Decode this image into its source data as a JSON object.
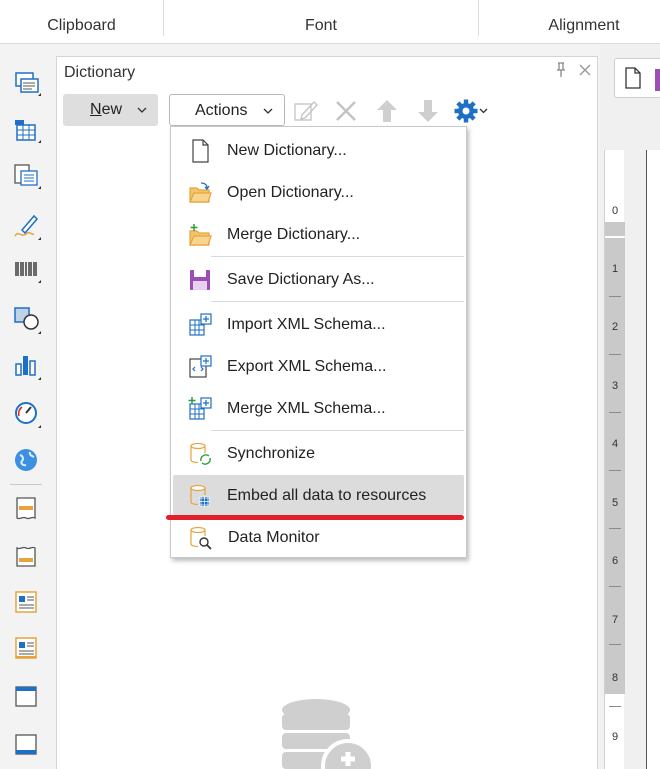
{
  "ribbon": {
    "groups": [
      "Clipboard",
      "Font",
      "Alignment"
    ]
  },
  "toolbox": {
    "items": [
      "text-icon",
      "table-icon",
      "cross-tab-icon",
      "shape-pen-icon",
      "barcode-icon",
      "shapes-icon",
      "chart-icon",
      "gauge-icon",
      "map-icon",
      "header-band-icon",
      "footer-band-icon",
      "data-band-icon",
      "databand-text-icon",
      "page-header-icon",
      "page-footer-icon"
    ]
  },
  "panel": {
    "title": "Dictionary",
    "new_button_prefix": "",
    "new_button_accel": "N",
    "new_button_rest": "ew",
    "actions_button": "Actions"
  },
  "menu": {
    "items": [
      {
        "label": "New Dictionary...",
        "icon": "new-document-icon"
      },
      {
        "label": "Open Dictionary...",
        "icon": "open-folder-icon"
      },
      {
        "label": "Merge Dictionary...",
        "icon": "merge-folder-icon"
      },
      {
        "label": "Save Dictionary As...",
        "icon": "save-icon"
      },
      {
        "label": "Import XML Schema...",
        "icon": "import-xml-icon"
      },
      {
        "label": "Export XML Schema...",
        "icon": "export-xml-icon"
      },
      {
        "label": "Merge XML Schema...",
        "icon": "merge-xml-icon"
      },
      {
        "label": "Synchronize",
        "icon": "synchronize-icon"
      },
      {
        "label": "Embed all data to resources",
        "icon": "embed-resources-icon"
      },
      {
        "label": "Data Monitor",
        "icon": "data-monitor-icon"
      }
    ],
    "highlighted_index": 8
  },
  "ruler": {
    "marks": [
      "0",
      "1",
      "2",
      "3",
      "4",
      "5",
      "6",
      "7",
      "8",
      "9"
    ]
  },
  "colors": {
    "accent": "#1e6fc6",
    "highlight": "#dcdcdc",
    "annotation_red": "#e0202a",
    "save_purple": "#9b4fb5",
    "folder_orange": "#e8a33c"
  }
}
